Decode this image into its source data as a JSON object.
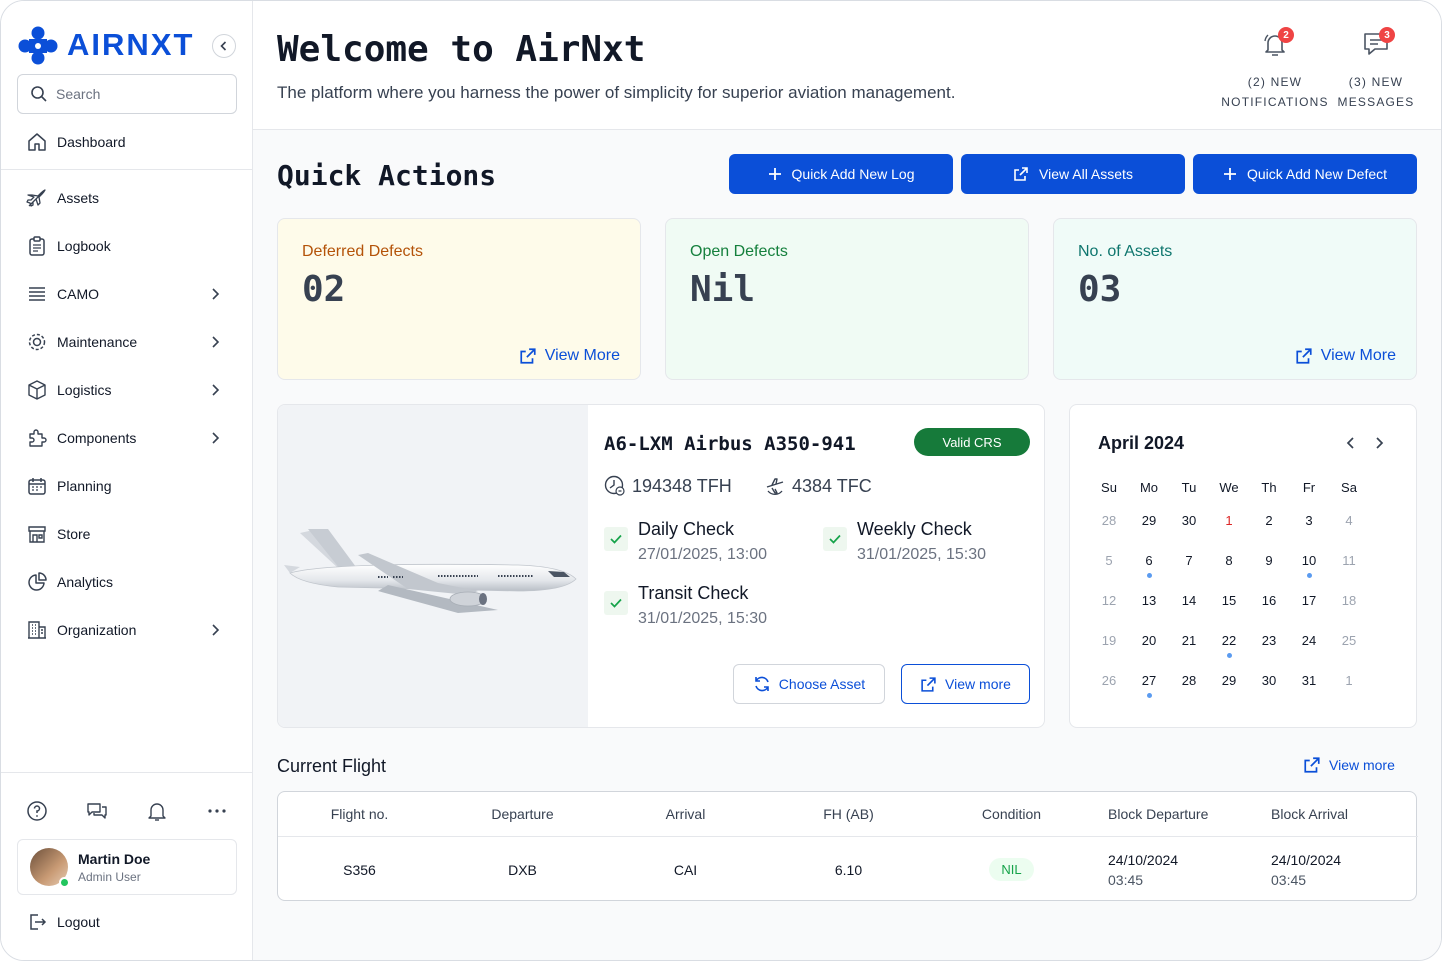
{
  "sidebar": {
    "brand": "AIRNXT",
    "search_placeholder": "Search",
    "items": [
      {
        "label": "Dashboard"
      },
      {
        "label": "Assets"
      },
      {
        "label": "Logbook"
      },
      {
        "label": "CAMO"
      },
      {
        "label": "Maintenance"
      },
      {
        "label": "Logistics"
      },
      {
        "label": "Components"
      },
      {
        "label": "Planning"
      },
      {
        "label": "Store"
      },
      {
        "label": "Analytics"
      },
      {
        "label": "Organization"
      }
    ],
    "user": {
      "name": "Martin Doe",
      "role": "Admin User"
    },
    "logout": "Logout"
  },
  "header": {
    "title": "Welcome to AirNxt",
    "tagline": "The platform where you harness the power of simplicity for superior aviation management.",
    "notifications": {
      "count": "2",
      "line1": "(2) NEW",
      "line2": "NOTIFICATIONS"
    },
    "messages": {
      "count": "3",
      "line1": "(3) NEW",
      "line2": "MESSAGES"
    }
  },
  "quick_actions": {
    "title": "Quick Actions",
    "buttons": [
      "Quick Add New Log",
      "View All Assets",
      "Quick Add New Defect"
    ]
  },
  "stats": [
    {
      "label": "Deferred Defects",
      "value": "02",
      "more": "View More",
      "color": "#b45309",
      "bg": "#fefbea"
    },
    {
      "label": "Open Defects",
      "value": "Nil",
      "more": "",
      "color": "#15803d",
      "bg": "#f0fbf4"
    },
    {
      "label": "No. of Assets",
      "value": "03",
      "more": "View More",
      "color": "#0f766e",
      "bg": "#f0fbf8"
    }
  ],
  "asset": {
    "title": "A6-LXM Airbus A350-941",
    "status": "Valid CRS",
    "tfh": "194348 TFH",
    "tfc": "4384 TFC",
    "checks": [
      {
        "name": "Daily Check",
        "date": "27/01/2025, 13:00"
      },
      {
        "name": "Weekly Check",
        "date": "31/01/2025, 15:30"
      },
      {
        "name": "Transit Check",
        "date": "31/01/2025, 15:30"
      }
    ],
    "choose_label": "Choose Asset",
    "view_label": "View more"
  },
  "calendar": {
    "title": "April 2024",
    "weekdays": [
      "Su",
      "Mo",
      "Tu",
      "We",
      "Th",
      "Fr",
      "Sa"
    ],
    "days": [
      {
        "d": "28",
        "muted": true
      },
      {
        "d": "29"
      },
      {
        "d": "30"
      },
      {
        "d": "1",
        "red": true
      },
      {
        "d": "2"
      },
      {
        "d": "3"
      },
      {
        "d": "4",
        "muted": true
      },
      {
        "d": "5",
        "muted": true
      },
      {
        "d": "6",
        "event": true
      },
      {
        "d": "7"
      },
      {
        "d": "8"
      },
      {
        "d": "9"
      },
      {
        "d": "10",
        "event": true
      },
      {
        "d": "11",
        "muted": true
      },
      {
        "d": "12",
        "muted": true
      },
      {
        "d": "13"
      },
      {
        "d": "14"
      },
      {
        "d": "15"
      },
      {
        "d": "16"
      },
      {
        "d": "17"
      },
      {
        "d": "18",
        "muted": true
      },
      {
        "d": "19",
        "muted": true
      },
      {
        "d": "20"
      },
      {
        "d": "21"
      },
      {
        "d": "22",
        "event": true
      },
      {
        "d": "23"
      },
      {
        "d": "24"
      },
      {
        "d": "25",
        "muted": true
      },
      {
        "d": "26",
        "muted": true
      },
      {
        "d": "27",
        "event": true
      },
      {
        "d": "28"
      },
      {
        "d": "29"
      },
      {
        "d": "30"
      },
      {
        "d": "31"
      },
      {
        "d": "1",
        "muted": true
      }
    ]
  },
  "current_flight": {
    "title": "Current Flight",
    "view_more": "View more",
    "columns": [
      "Flight no.",
      "Departure",
      "Arrival",
      "FH (AB)",
      "Condition",
      "Block Departure",
      "Block Arrival"
    ],
    "row": {
      "flight": "S356",
      "departure": "DXB",
      "arrival": "CAI",
      "fh": "6.10",
      "condition": "NIL",
      "block_dep_date": "24/10/2024",
      "block_dep_time": "03:45",
      "block_arr_date": "24/10/2024",
      "block_arr_time": "03:45"
    }
  }
}
